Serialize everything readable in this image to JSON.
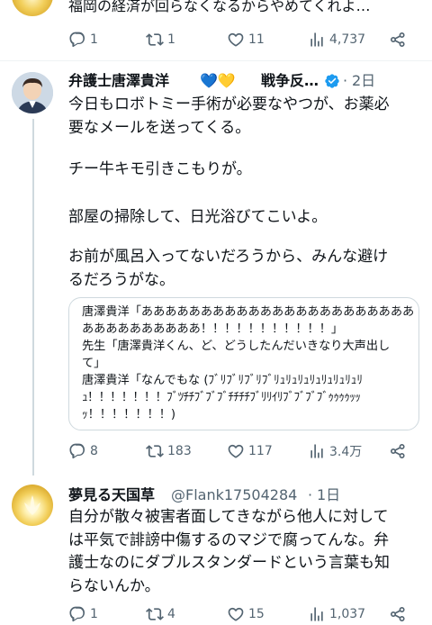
{
  "prev_post": {
    "text": "福岡の経済が回らなくなるからやめてくれよ…",
    "actions": {
      "replies": "1",
      "retweets": "1",
      "likes": "11",
      "views": "4,737"
    }
  },
  "post": {
    "author": "弁護士唐澤貴洋",
    "hearts": "💙💛",
    "bio_trunc": "戦争反…",
    "time": "2日",
    "lines": [
      "今日もロボトミー手術が必要なやつが、お薬必",
      "要なメールを送ってくる。",
      "チー牛キモ引きこもりが。",
      "部屋の掃除して、日光浴びてこいよ。",
      "お前が風呂入ってないだろうから、みんな避け",
      "るだろうがな。"
    ],
    "quote_lines": [
      "唐澤貴洋「あああああああああああああああああああああああ",
      "ああああああああああ！！！！！！！！！！！」",
      "先生「唐澤貴洋くん、ど、どうしたんだいきなり大声出し",
      "て」",
      "唐澤貴洋「なんでもな (ﾌﾞﾘﾌﾞﾘﾌﾞﾘﾌﾞﾘｭﾘｭﾘｭﾘｭﾘｭﾘｭﾘｭﾘ",
      "ｭ！！！！！！！ﾌﾞﾂﾁﾁﾌﾞﾌﾞﾌﾞﾁﾁﾁﾁﾌﾞﾘﾘｲﾘﾌﾞﾌﾞﾌﾞﾌﾞｩｩｩｩｯｯ",
      "ｯ！！！！！！！)"
    ],
    "actions": {
      "replies": "8",
      "retweets": "183",
      "likes": "117",
      "views": "3.4万"
    }
  },
  "reply": {
    "author": "夢見る天国草",
    "handle": "@Flank17504284",
    "sep": "·",
    "time": "1日",
    "lines": [
      "自分が散々被害者面してきながら他人に対して",
      "は平気で誹謗中傷するのマジで腐ってんな。弁",
      "護士なのにダブルスタンダードという言葉も知",
      "らないんか。"
    ],
    "actions": {
      "replies": "1",
      "retweets": "4",
      "likes": "15",
      "views": "1,037"
    }
  },
  "colors": {
    "text": "#0f1419",
    "secondary": "#536471",
    "verified": "#1d9bf0",
    "border": "#cfd9de"
  },
  "icons": [
    "reply-icon",
    "retweet-icon",
    "like-icon",
    "views-icon",
    "share-icon",
    "verified-icon"
  ]
}
